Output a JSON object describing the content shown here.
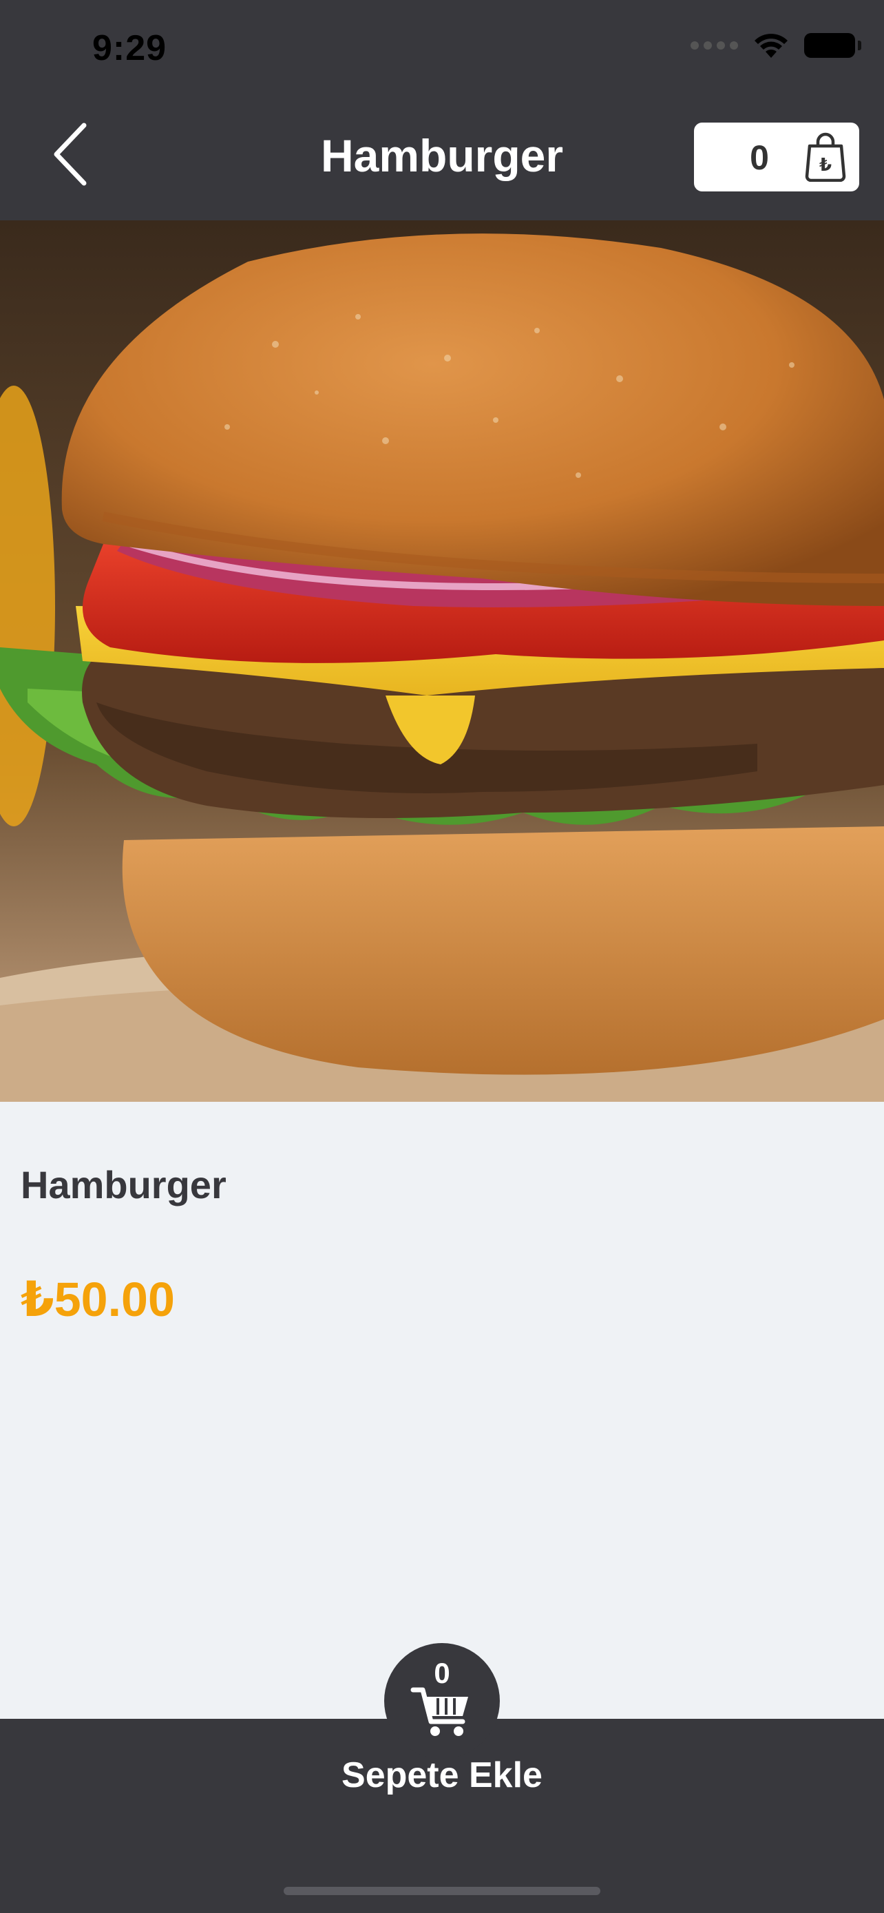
{
  "status_bar": {
    "time": "9:29"
  },
  "header": {
    "title": "Hamburger",
    "cart_count": "0",
    "back_icon": "chevron-left-icon",
    "cart_icon": "shopping-bag-lira-icon",
    "background_color": "#38383d"
  },
  "product": {
    "name": "Hamburger",
    "price": "₺50.00",
    "image": "hamburger-photo",
    "price_color": "#f5a20a"
  },
  "bottom_bar": {
    "cart_badge_count": "0",
    "add_to_cart_label": "Sepete Ekle",
    "cart_icon": "shopping-cart-icon"
  }
}
